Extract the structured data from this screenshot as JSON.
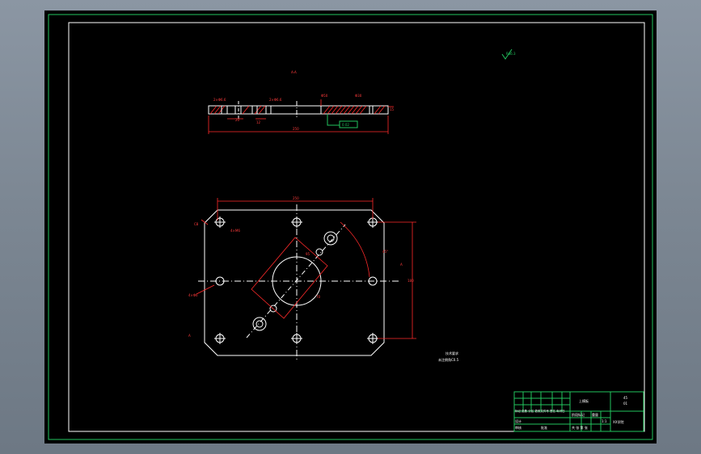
{
  "section_label": "A-A",
  "roughness_mark": "Ra6.3",
  "section_view": {
    "overall_length": "250",
    "hole_note_left": "2×Φ6.6",
    "hole_note_mid": "2×Φ6.6",
    "dim_a": "20",
    "dim_b": "12",
    "dim_c": "Φ50",
    "dim_d": "Φ30",
    "dim_e": "15",
    "tolerance_frame": "0.02"
  },
  "plan_view": {
    "width_dim": "250",
    "height_dim": "180",
    "chamfer_note": "C8",
    "note_left_top": "4×M6",
    "note_left_mid": "4×Φ6",
    "angle_dim": "45°",
    "diag_dim_1": "95",
    "diag_dim_2": "70",
    "view_label": "A",
    "view_label_2": "A"
  },
  "tech_notes": {
    "title": "技术要求",
    "line1": "未注倒角C0.5"
  },
  "title_block": {
    "part_name": "上模板",
    "material": "45",
    "drawing_no": "01",
    "company": "XX学院",
    "scale": "1:1",
    "row_labels": "标记 处数 分区 更改文件号 签名 年月日",
    "design": "设计",
    "check": "审核",
    "process": "工艺",
    "approve": "批准",
    "stage": "阶段标记",
    "weight": "重量",
    "ratio": "比例",
    "sheet": "共 张 第 张"
  }
}
